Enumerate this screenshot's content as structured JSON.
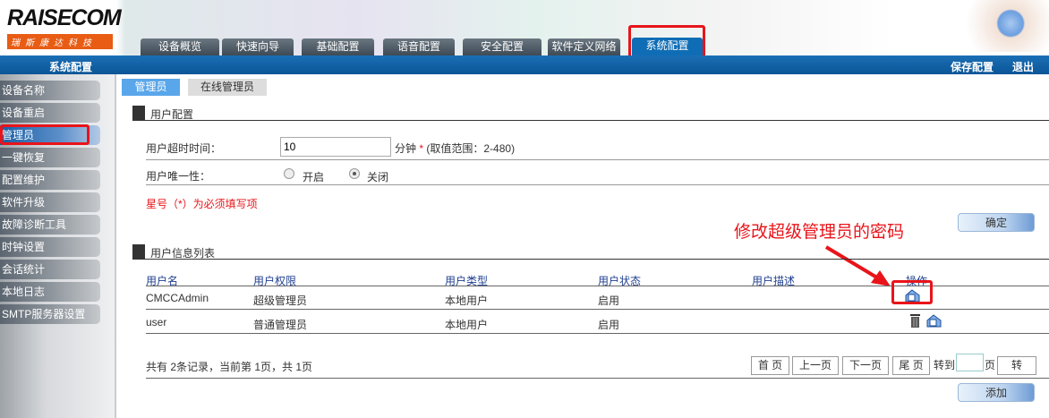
{
  "logo": {
    "brand": "RAISECOM",
    "subtitle": "瑞斯康达科技"
  },
  "top_tabs": [
    {
      "label": "设备概览"
    },
    {
      "label": "快速向导"
    },
    {
      "label": "基础配置"
    },
    {
      "label": "语音配置"
    },
    {
      "label": "安全配置"
    },
    {
      "label": "软件定义网络"
    },
    {
      "label": "系统配置"
    }
  ],
  "bar": {
    "title": "系统配置",
    "save": "保存配置",
    "logout": "退出"
  },
  "sidebar": [
    "设备名称",
    "设备重启",
    "管理员",
    "一键恢复",
    "配置维护",
    "软件升级",
    "故障诊断工具",
    "时钟设置",
    "会话统计",
    "本地日志",
    "SMTP服务器设置"
  ],
  "sub_tabs": [
    "管理员",
    "在线管理员"
  ],
  "user_config": {
    "title": "用户配置",
    "timeout_label": "用户超时时间：",
    "timeout_value": "10",
    "timeout_unit": "分钟",
    "required_mark": "*",
    "timeout_range": "(取值范围：2-480)",
    "unique_label": "用户唯一性：",
    "opt_on": "开启",
    "opt_off": "关闭",
    "selected": "关闭",
    "note": "星号（*）为必须填写项",
    "confirm": "确定"
  },
  "annotation": "修改超级管理员的密码",
  "user_list": {
    "title": "用户信息列表",
    "columns": [
      "用户名",
      "用户权限",
      "用户类型",
      "用户状态",
      "用户描述",
      "操作"
    ],
    "rows": [
      {
        "name": "CMCCAdmin",
        "role": "超级管理员",
        "type": "本地用户",
        "status": "启用",
        "desc": ""
      },
      {
        "name": "user",
        "role": "普通管理员",
        "type": "本地用户",
        "status": "启用",
        "desc": ""
      }
    ]
  },
  "pagination": {
    "summary": "共有 2条记录，当前第 1页，共 1页",
    "first": "首 页",
    "prev": "上一页",
    "next": "下一页",
    "last": "尾 页",
    "goto": "转到",
    "page_value": "",
    "page_unit": "页",
    "go": "转"
  },
  "add": "添加",
  "colors": {
    "accent": "#0f6db5",
    "highlight": "#e8141a"
  }
}
